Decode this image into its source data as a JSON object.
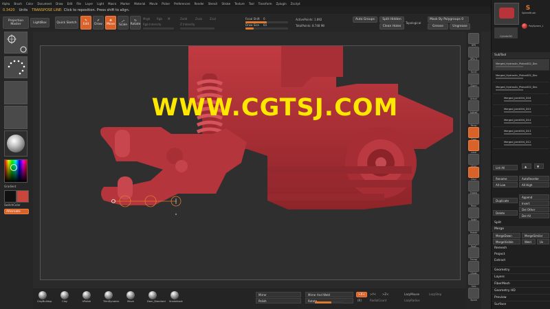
{
  "menu": [
    "Alpha",
    "Brush",
    "Color",
    "Document",
    "Draw",
    "Edit",
    "File",
    "Layer",
    "Light",
    "Macro",
    "Marker",
    "Material",
    "Movie",
    "Picker",
    "Preferences",
    "Render",
    "Stencil",
    "Stroke",
    "Texture",
    "Tool",
    "Transform",
    "Zplugin",
    "Zscript"
  ],
  "status": {
    "version": "0.3420",
    "mode": "Units",
    "hint_label": "TRANSPOSE LINE:",
    "hint_text": "Click to reposition. Press shift to align."
  },
  "toolbar": {
    "projection_master": "Projection Master",
    "lightbox": "LightBox",
    "quick_sketch": "Quick Sketch",
    "edit": "Edit",
    "draw": "Draw",
    "move": "Move",
    "scale": "Scale",
    "rotate": "Rotate",
    "mrgb": "Mrgb",
    "rgb": "Rgb",
    "m": "M",
    "zadd": "Zadd",
    "zsub": "Zsub",
    "zcut": "Zcut",
    "rgb_intensity": "Rgb Intensity",
    "z_intensity": "Z Intensity",
    "focal_shift_label": "Focal Shift",
    "focal_shift_value": "0",
    "draw_size_label": "Draw Size",
    "draw_size_value": "64",
    "active_points": "ActivePoints: 1.892",
    "total_points": "TotalPoints: 8.748 Mil",
    "auto_groups": "Auto Groups",
    "split_hidden": "Split Hidden",
    "clean_holes": "Clean Holes",
    "topological": "Topological",
    "mask_by_polygroups": "Mask By Polygroups",
    "mask_by_polygroups_value": "0",
    "grease": "Grease",
    "ungrease": "Ungrease"
  },
  "left": {
    "gradient": "Gradient",
    "switch_color": "SwitchColor",
    "alternate": "Alternate"
  },
  "right_shelf": [
    "BPR",
    "SPix 3",
    "Scroll",
    "Zoom",
    "Actual",
    "AAHalf",
    "Persp",
    "Floor",
    "Local",
    "LSym",
    "Qxyz",
    "Frame",
    "Move",
    "Scale",
    "Rotate",
    "PolyF",
    "Transp",
    "Ghost",
    "Solo",
    "Xpose"
  ],
  "right_panel": {
    "tools": [
      "SphereBrush",
      "PolySphere_1",
      "Cylinder3D"
    ],
    "subtool_title": "SubTool",
    "subtools": [
      "Merged_Hydraulic_Piston002_Dec",
      "Merged_Hydraulic_Piston002_Dec",
      "Merged_Hydraulic_Piston002_Dec",
      "Merged_Joint004_D16",
      "Merged_Joint004_D15",
      "Merged_Joint004_D14",
      "Merged_Joint004_D13",
      "Merged_Joint004_D12"
    ],
    "list_all": "List All",
    "rename": "Rename",
    "auto_reorder": "AutoReorder",
    "all_low": "All Low",
    "all_high": "All High",
    "append": "Append",
    "duplicate": "Duplicate",
    "insert": "Insert",
    "delete": "Delete",
    "del_other": "Del Other",
    "del_all": "Del All",
    "split": "Split",
    "merge": "Merge",
    "merge_down": "MergeDown",
    "merge_similar": "MergeSimilar",
    "merge_visible": "MergeVisible",
    "weld": "Weld",
    "uv": "Uv",
    "remesh": "Remesh",
    "project": "Project",
    "extract": "Extract",
    "sections": [
      "Geometry",
      "Layers",
      "FiberMesh",
      "Geometry HD",
      "Preview",
      "Surface"
    ]
  },
  "bottom": {
    "brushes": [
      "ClayBuildup",
      "Clay",
      "hPolish",
      "TrimDynamic",
      "Move",
      "Dam_Standard",
      "Snakehook"
    ],
    "mirror": "Mirror",
    "polish": "Polish",
    "mirror_and_weld": "Mirror And Weld",
    "rotate": "Rotate",
    "x": ">X<",
    "y": ">Y<",
    "z": ">Z<",
    "r": "(R)",
    "radial_count": "RadialCount",
    "lazy_mouse": "LazyMouse",
    "lazy_radius": "LazyRadius",
    "lazy_step": "LazyStep"
  },
  "watermark": "WWW.CGTSJ.COM",
  "colors": {
    "accent": "#d9622a",
    "model": "#b8343b",
    "watermark": "#ffe800"
  }
}
